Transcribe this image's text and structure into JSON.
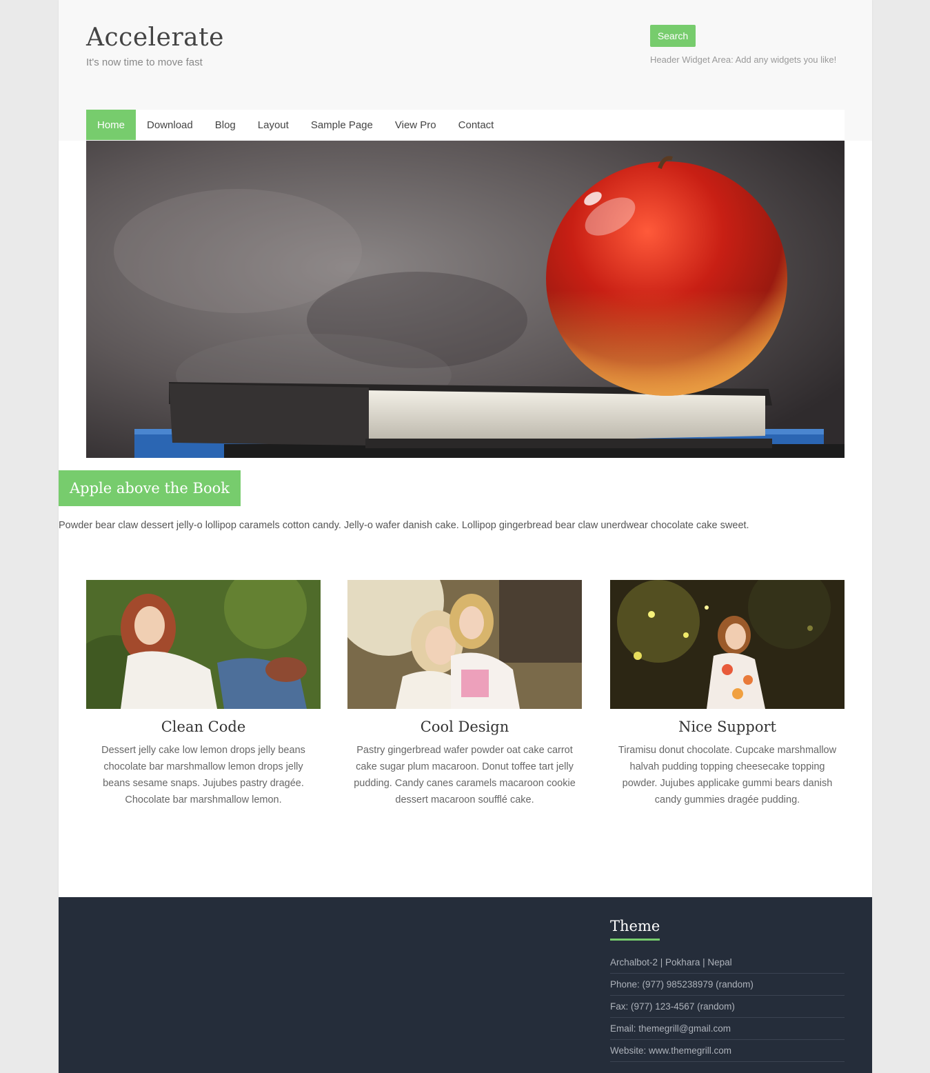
{
  "header": {
    "site_title": "Accelerate",
    "tagline": "It's now time to move fast",
    "search_label": "Search",
    "widget_note": "Header Widget Area: Add any widgets you like!"
  },
  "nav": {
    "items": [
      {
        "label": "Home",
        "active": true
      },
      {
        "label": "Download"
      },
      {
        "label": "Blog"
      },
      {
        "label": "Layout"
      },
      {
        "label": "Sample Page"
      },
      {
        "label": "View Pro"
      },
      {
        "label": "Contact"
      }
    ]
  },
  "slider": {
    "caption_title": "Apple above the Book",
    "caption_text": "Powder bear claw dessert jelly-o lollipop caramels cotton candy. Jelly-o wafer danish cake. Lollipop gingerbread bear claw unerdwear chocolate cake sweet."
  },
  "features": [
    {
      "title": "Clean Code",
      "text": "Dessert jelly cake low lemon drops jelly beans chocolate bar marshmallow lemon drops jelly beans sesame snaps. Jujubes pastry dragée. Chocolate bar marshmallow lemon."
    },
    {
      "title": "Cool Design",
      "text": "Pastry gingerbread wafer powder oat cake carrot cake sugar plum macaroon. Donut toffee tart jelly pudding. Candy canes caramels macaroon cookie dessert macaroon soufflé cake."
    },
    {
      "title": "Nice Support",
      "text": "Tiramisu donut chocolate. Cupcake marshmallow halvah pudding topping cheesecake topping powder. Jujubes applicake gummi bears danish candy gummies dragée pudding."
    }
  ],
  "footer": {
    "widget_title": "Theme",
    "lines": [
      "Archalbot-2 | Pokhara | Nepal",
      "Phone: (977) 985238979 (random)",
      "Fax: (977) 123-4567 (random)",
      "Email: themegrill@gmail.com",
      "Website: www.themegrill.com"
    ]
  },
  "colors": {
    "accent": "#77cc6d",
    "footer_bg": "#252d3a",
    "header_bg": "#f8f8f8"
  }
}
